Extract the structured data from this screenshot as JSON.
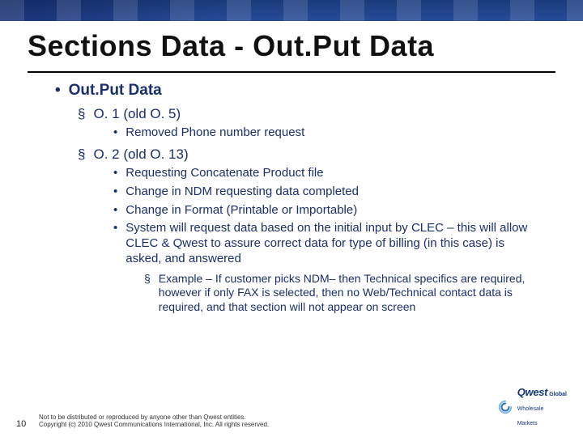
{
  "title": "Sections Data - Out.Put Data",
  "content": {
    "heading": "Out.Put Data",
    "sec1": {
      "title": "O. 1 (old O. 5)",
      "items": [
        "Removed Phone number request"
      ]
    },
    "sec2": {
      "title": "O. 2 (old O. 13)",
      "items": [
        "Requesting Concatenate Product file",
        "Change in NDM requesting data completed",
        "Change in Format (Printable or Importable)",
        "System will request data based on the initial input by CLEC – this will allow CLEC & Qwest to assure correct data for type of billing (in this case) is asked, and answered"
      ],
      "example": "Example – If customer picks NDM– then Technical specifics are required, however if only FAX is selected, then no Web/Technical contact data is required, and that section will not appear on screen"
    }
  },
  "footer": {
    "page": "10",
    "line1": "Not to be distributed or reproduced by anyone other than Qwest entities.",
    "line2": "Copyright (c) 2010 Qwest Communications International, Inc. All rights reserved.",
    "brand": "Qwest",
    "sub1": "Global",
    "sub2": "Wholesale",
    "sub3": "Markets"
  }
}
